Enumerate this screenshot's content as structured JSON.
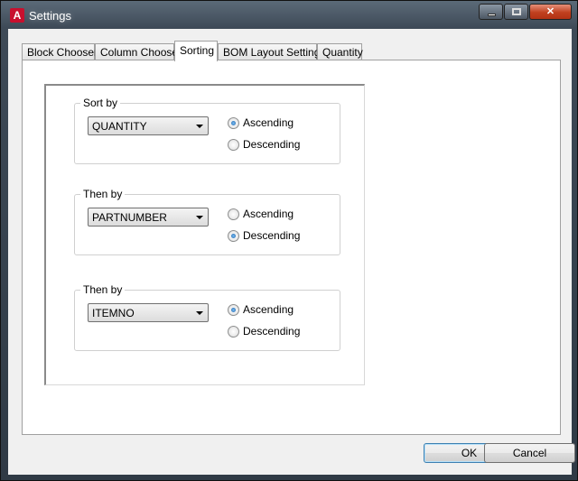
{
  "window": {
    "title": "Settings",
    "app_icon_letter": "A",
    "controls": {
      "close_glyph": "✕"
    }
  },
  "tabs": [
    {
      "label": "Block Chooser",
      "active": false
    },
    {
      "label": "Column Chooser",
      "active": false
    },
    {
      "label": "Sorting",
      "active": true
    },
    {
      "label": "BOM Layout Settings",
      "active": false
    },
    {
      "label": "Quantity",
      "active": false
    }
  ],
  "sorting": {
    "groups": [
      {
        "label": "Sort by",
        "field": "QUANTITY",
        "ascending_label": "Ascending",
        "descending_label": "Descending",
        "order": "ascending"
      },
      {
        "label": "Then by",
        "field": "PARTNUMBER",
        "ascending_label": "Ascending",
        "descending_label": "Descending",
        "order": "descending"
      },
      {
        "label": "Then by",
        "field": "ITEMNO",
        "ascending_label": "Ascending",
        "descending_label": "Descending",
        "order": "ascending"
      }
    ]
  },
  "buttons": {
    "ok": "OK",
    "cancel": "Cancel"
  }
}
